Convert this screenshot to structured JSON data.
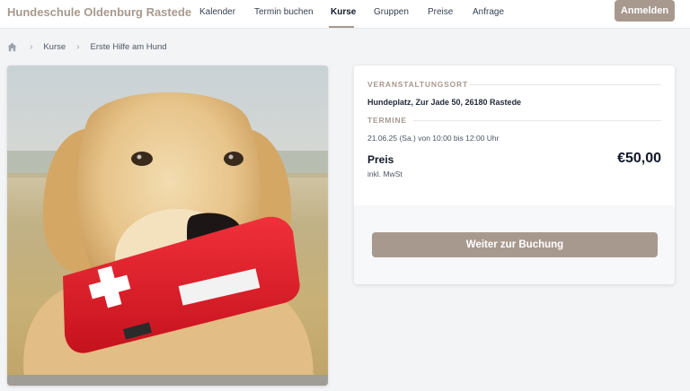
{
  "header": {
    "brand": "Hundeschule Oldenburg Rastede",
    "nav": [
      {
        "label": "Kalender"
      },
      {
        "label": "Termin buchen"
      },
      {
        "label": "Kurse"
      },
      {
        "label": "Gruppen"
      },
      {
        "label": "Preise"
      },
      {
        "label": "Anfrage"
      }
    ],
    "active_nav": "Kurse",
    "login_label": "Anmelden"
  },
  "breadcrumb": {
    "items": [
      "Kurse",
      "Erste Hilfe am Hund"
    ]
  },
  "image": {
    "subject": "Golden Retriever mit Erste-Hilfe-Tasche"
  },
  "details": {
    "location_label": "VERANSTALTUNGSORT",
    "location_value": "Hundeplatz, Zur Jade 50, 26180 Rastede",
    "dates_label": "TERMINE",
    "dates_value": "21.06.25 (Sa.) von 10:00 bis 12:00 Uhr",
    "price_label": "Preis",
    "price_value": "€50,00",
    "tax_note": "inkl. MwSt",
    "book_label": "Weiter zur Buchung"
  },
  "colors": {
    "accent": "#a8998f",
    "background": "#f3f4f6",
    "card": "#ffffff"
  },
  "icons": [
    "home-icon",
    "chevron-right-icon"
  ]
}
